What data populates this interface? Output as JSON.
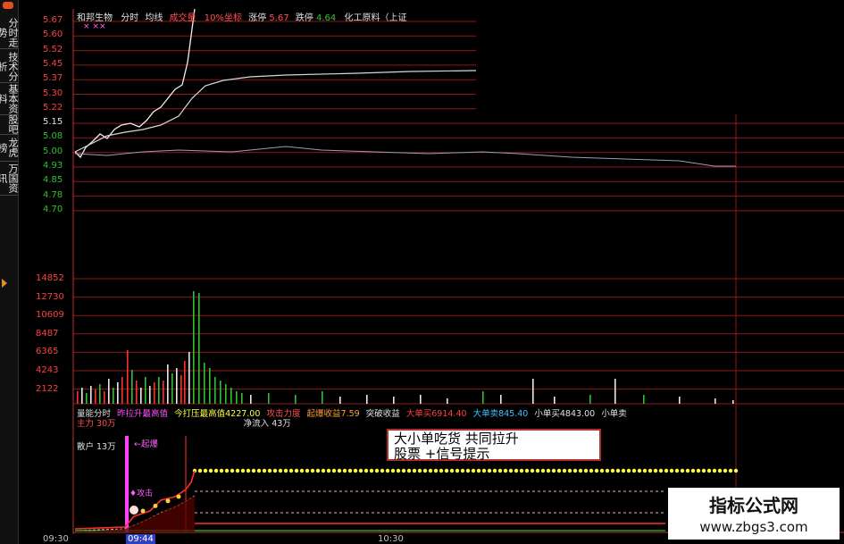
{
  "left_tabs": [
    "分时走势",
    "技术分析",
    "基本资料",
    "股吧",
    "龙虎榜",
    "万国资讯"
  ],
  "header": {
    "stock": "和邦生物",
    "view": "分时",
    "avg": "均线",
    "vol": "成交量",
    "ratio": "10%坐标",
    "limit_up_label": "涨停",
    "limit_up": "5.67",
    "limit_down_label": "跌停",
    "limit_down": "4.64",
    "sector": "化工原料（上证"
  },
  "price_axis": [
    "5.67",
    "5.60",
    "5.52",
    "5.45",
    "5.37",
    "5.30",
    "5.22",
    "5.15",
    "5.08",
    "5.00",
    "4.93",
    "4.85",
    "4.78",
    "4.70"
  ],
  "volume_axis": [
    "14852",
    "12730",
    "10609",
    "8487",
    "6365",
    "4243",
    "2122"
  ],
  "time_axis": {
    "start": "09:30",
    "cursor": "09:44",
    "mid": "10:30"
  },
  "indicator_header": {
    "name": "量能分时",
    "i1": "昨拉升最高值",
    "i2": "今打压最高值",
    "i2v": "4227.00",
    "i3": "攻击力度",
    "i4": "起爆收益",
    "i4v": "7.59",
    "i5": "突破收益",
    "i6": "大单买",
    "i6v": "6914.40",
    "i7": "大单卖",
    "i7v": "845.40",
    "i8": "小单买",
    "i8v": "4843.00",
    "i9": "小单卖"
  },
  "indicator_line2": {
    "main": "主力",
    "main_v": "30万",
    "net": "净流入",
    "net_v": "43万"
  },
  "labels": {
    "retail": "散户",
    "retail_v": "13万",
    "ignite": "起爆",
    "attack": "攻击"
  },
  "annotation": {
    "line1": "大小单吃货  共同拉升",
    "line2": "股票  +信号提示"
  },
  "watermark": {
    "title": "指标公式网",
    "url": "www.zbgs3.com"
  },
  "colors": {
    "grid": "#8b1a1a",
    "price": "#ffffff",
    "avg": "#c8c8c8",
    "up": "#ff3030",
    "down": "#30c030",
    "yellow": "#ffff40",
    "magenta": "#ff40ff"
  }
}
